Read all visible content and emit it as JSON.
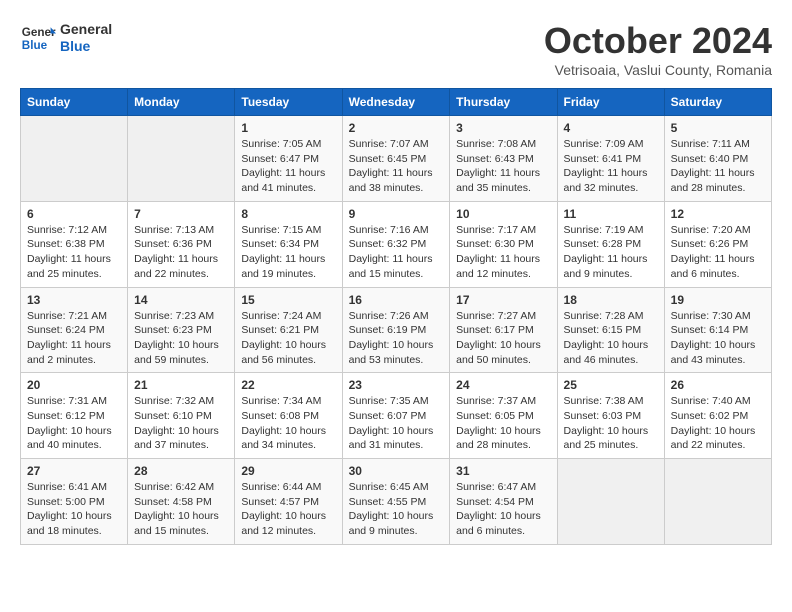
{
  "logo": {
    "line1": "General",
    "line2": "Blue"
  },
  "title": "October 2024",
  "subtitle": "Vetrisoaia, Vaslui County, Romania",
  "weekdays": [
    "Sunday",
    "Monday",
    "Tuesday",
    "Wednesday",
    "Thursday",
    "Friday",
    "Saturday"
  ],
  "weeks": [
    [
      {
        "day": "",
        "info": ""
      },
      {
        "day": "",
        "info": ""
      },
      {
        "day": "1",
        "info": "Sunrise: 7:05 AM\nSunset: 6:47 PM\nDaylight: 11 hours and 41 minutes."
      },
      {
        "day": "2",
        "info": "Sunrise: 7:07 AM\nSunset: 6:45 PM\nDaylight: 11 hours and 38 minutes."
      },
      {
        "day": "3",
        "info": "Sunrise: 7:08 AM\nSunset: 6:43 PM\nDaylight: 11 hours and 35 minutes."
      },
      {
        "day": "4",
        "info": "Sunrise: 7:09 AM\nSunset: 6:41 PM\nDaylight: 11 hours and 32 minutes."
      },
      {
        "day": "5",
        "info": "Sunrise: 7:11 AM\nSunset: 6:40 PM\nDaylight: 11 hours and 28 minutes."
      }
    ],
    [
      {
        "day": "6",
        "info": "Sunrise: 7:12 AM\nSunset: 6:38 PM\nDaylight: 11 hours and 25 minutes."
      },
      {
        "day": "7",
        "info": "Sunrise: 7:13 AM\nSunset: 6:36 PM\nDaylight: 11 hours and 22 minutes."
      },
      {
        "day": "8",
        "info": "Sunrise: 7:15 AM\nSunset: 6:34 PM\nDaylight: 11 hours and 19 minutes."
      },
      {
        "day": "9",
        "info": "Sunrise: 7:16 AM\nSunset: 6:32 PM\nDaylight: 11 hours and 15 minutes."
      },
      {
        "day": "10",
        "info": "Sunrise: 7:17 AM\nSunset: 6:30 PM\nDaylight: 11 hours and 12 minutes."
      },
      {
        "day": "11",
        "info": "Sunrise: 7:19 AM\nSunset: 6:28 PM\nDaylight: 11 hours and 9 minutes."
      },
      {
        "day": "12",
        "info": "Sunrise: 7:20 AM\nSunset: 6:26 PM\nDaylight: 11 hours and 6 minutes."
      }
    ],
    [
      {
        "day": "13",
        "info": "Sunrise: 7:21 AM\nSunset: 6:24 PM\nDaylight: 11 hours and 2 minutes."
      },
      {
        "day": "14",
        "info": "Sunrise: 7:23 AM\nSunset: 6:23 PM\nDaylight: 10 hours and 59 minutes."
      },
      {
        "day": "15",
        "info": "Sunrise: 7:24 AM\nSunset: 6:21 PM\nDaylight: 10 hours and 56 minutes."
      },
      {
        "day": "16",
        "info": "Sunrise: 7:26 AM\nSunset: 6:19 PM\nDaylight: 10 hours and 53 minutes."
      },
      {
        "day": "17",
        "info": "Sunrise: 7:27 AM\nSunset: 6:17 PM\nDaylight: 10 hours and 50 minutes."
      },
      {
        "day": "18",
        "info": "Sunrise: 7:28 AM\nSunset: 6:15 PM\nDaylight: 10 hours and 46 minutes."
      },
      {
        "day": "19",
        "info": "Sunrise: 7:30 AM\nSunset: 6:14 PM\nDaylight: 10 hours and 43 minutes."
      }
    ],
    [
      {
        "day": "20",
        "info": "Sunrise: 7:31 AM\nSunset: 6:12 PM\nDaylight: 10 hours and 40 minutes."
      },
      {
        "day": "21",
        "info": "Sunrise: 7:32 AM\nSunset: 6:10 PM\nDaylight: 10 hours and 37 minutes."
      },
      {
        "day": "22",
        "info": "Sunrise: 7:34 AM\nSunset: 6:08 PM\nDaylight: 10 hours and 34 minutes."
      },
      {
        "day": "23",
        "info": "Sunrise: 7:35 AM\nSunset: 6:07 PM\nDaylight: 10 hours and 31 minutes."
      },
      {
        "day": "24",
        "info": "Sunrise: 7:37 AM\nSunset: 6:05 PM\nDaylight: 10 hours and 28 minutes."
      },
      {
        "day": "25",
        "info": "Sunrise: 7:38 AM\nSunset: 6:03 PM\nDaylight: 10 hours and 25 minutes."
      },
      {
        "day": "26",
        "info": "Sunrise: 7:40 AM\nSunset: 6:02 PM\nDaylight: 10 hours and 22 minutes."
      }
    ],
    [
      {
        "day": "27",
        "info": "Sunrise: 6:41 AM\nSunset: 5:00 PM\nDaylight: 10 hours and 18 minutes."
      },
      {
        "day": "28",
        "info": "Sunrise: 6:42 AM\nSunset: 4:58 PM\nDaylight: 10 hours and 15 minutes."
      },
      {
        "day": "29",
        "info": "Sunrise: 6:44 AM\nSunset: 4:57 PM\nDaylight: 10 hours and 12 minutes."
      },
      {
        "day": "30",
        "info": "Sunrise: 6:45 AM\nSunset: 4:55 PM\nDaylight: 10 hours and 9 minutes."
      },
      {
        "day": "31",
        "info": "Sunrise: 6:47 AM\nSunset: 4:54 PM\nDaylight: 10 hours and 6 minutes."
      },
      {
        "day": "",
        "info": ""
      },
      {
        "day": "",
        "info": ""
      }
    ]
  ]
}
